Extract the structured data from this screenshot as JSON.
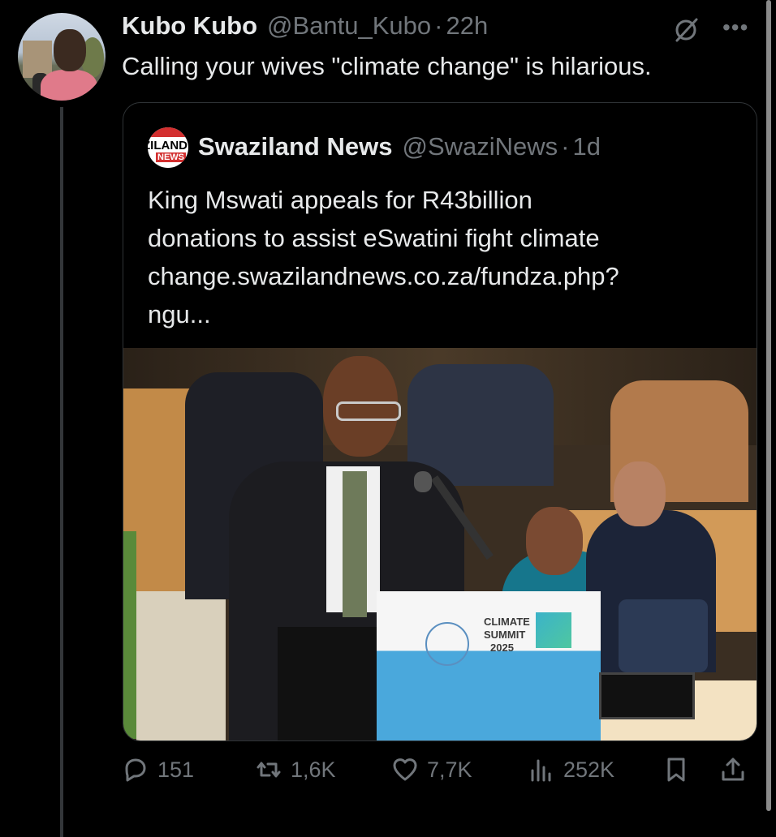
{
  "tweet": {
    "author_name": "Kubo Kubo",
    "author_handle": "@Bantu_Kubo",
    "separator": "·",
    "time": "22h",
    "text": "Calling your wives \"climate change\" is hilarious.",
    "avatar_icon": "profile-photo"
  },
  "quoted": {
    "author_name": "Swaziland News",
    "author_handle": "@SwaziNews",
    "separator": "·",
    "time": "1d",
    "avatar_text_1": "ZILAND",
    "avatar_text_2": "NEWS",
    "text_lines": [
      "King Mswati appeals for R43billion",
      "donations to assist eSwatini fight climate",
      "change.swazilandnews.co.za/fundza.php?",
      "ngu..."
    ],
    "image": {
      "podium_line1": "CLIMATE",
      "podium_line2": "SUMMIT",
      "podium_line3": "2025"
    }
  },
  "actions": {
    "replies": "151",
    "reposts": "1,6K",
    "likes": "7,7K",
    "views": "252K"
  },
  "colors": {
    "background": "#000000",
    "text_primary": "#e7e9ea",
    "text_secondary": "#71767b",
    "border": "#2f3336"
  }
}
